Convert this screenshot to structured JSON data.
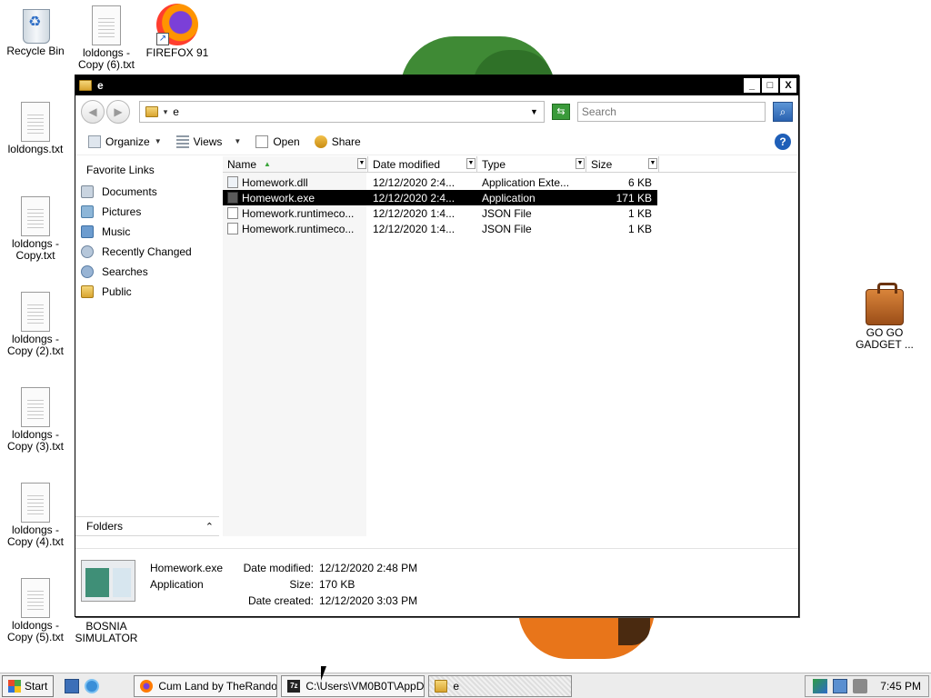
{
  "desktop": {
    "icons": [
      {
        "label": "Recycle Bin",
        "icon": "recycle-bin-icon"
      },
      {
        "label": "loldongs - Copy (6).txt",
        "icon": "text-file-icon"
      },
      {
        "label": "FIREFOX 91",
        "icon": "firefox-icon"
      },
      {
        "label": "loldongs.txt",
        "icon": "text-file-icon"
      },
      {
        "label": "loldongs - Copy.txt",
        "icon": "text-file-icon"
      },
      {
        "label": "loldongs - Copy (2).txt",
        "icon": "text-file-icon"
      },
      {
        "label": "loldongs - Copy (3).txt",
        "icon": "text-file-icon"
      },
      {
        "label": "loldongs - Copy (4).txt",
        "icon": "text-file-icon"
      },
      {
        "label": "loldongs - Copy (5).txt",
        "icon": "text-file-icon"
      },
      {
        "label": "BOSNIA SIMULATOR",
        "icon": "text-file-icon"
      },
      {
        "label": "GO GO GADGET ...",
        "icon": "briefcase-icon"
      }
    ]
  },
  "window": {
    "title": "e",
    "controls": {
      "minimize": "_",
      "maximize": "□",
      "close": "X"
    },
    "address": {
      "path": "e"
    },
    "search": {
      "placeholder": "Search"
    },
    "toolbar": {
      "organize": "Organize",
      "views": "Views",
      "open": "Open",
      "share": "Share"
    },
    "nav": {
      "heading": "Favorite Links",
      "items": [
        "Documents",
        "Pictures",
        "Music",
        "Recently Changed",
        "Searches",
        "Public"
      ],
      "folders_label": "Folders"
    },
    "columns": {
      "name": "Name",
      "date": "Date modified",
      "type": "Type",
      "size": "Size"
    },
    "files": [
      {
        "name": "Homework.dll",
        "date": "12/12/2020 2:4...",
        "type": "Application Exte...",
        "size": "6 KB",
        "icon": "dll-file-icon",
        "selected": false
      },
      {
        "name": "Homework.exe",
        "date": "12/12/2020 2:4...",
        "type": "Application",
        "size": "171 KB",
        "icon": "exe-file-icon",
        "selected": true
      },
      {
        "name": "Homework.runtimeco...",
        "date": "12/12/2020 1:4...",
        "type": "JSON File",
        "size": "1 KB",
        "icon": "json-file-icon",
        "selected": false
      },
      {
        "name": "Homework.runtimeco...",
        "date": "12/12/2020 1:4...",
        "type": "JSON File",
        "size": "1 KB",
        "icon": "json-file-icon",
        "selected": false
      }
    ],
    "details": {
      "name": "Homework.exe",
      "kind": "Application",
      "labels": {
        "modified": "Date modified:",
        "size": "Size:",
        "created": "Date created:"
      },
      "values": {
        "modified": "12/12/2020 2:48 PM",
        "size": "170 KB",
        "created": "12/12/2020 3:03 PM"
      }
    }
  },
  "taskbar": {
    "start": "Start",
    "tasks": [
      {
        "label": "Cum Land by TheRando...",
        "icon": "firefox-icon"
      },
      {
        "label": "C:\\Users\\VM0B0T\\AppD...",
        "icon": "7zip-icon"
      },
      {
        "label": "e",
        "icon": "folder-icon"
      }
    ],
    "clock": "7:45 PM"
  },
  "colors": {
    "selection": "#000000",
    "titlebar": "#000000",
    "search_text": "#3aa53a"
  }
}
